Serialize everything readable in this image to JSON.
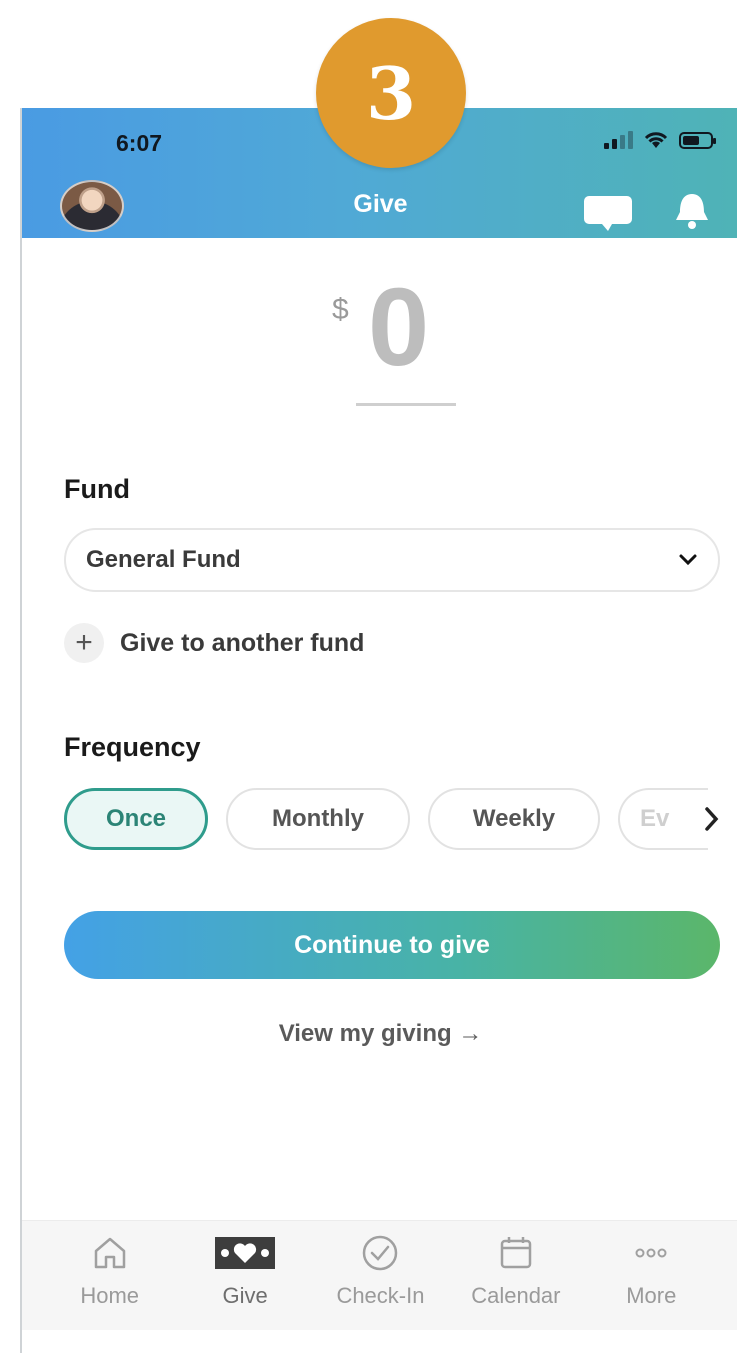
{
  "step": {
    "number": "3"
  },
  "status_bar": {
    "time": "6:07"
  },
  "header": {
    "title": "Give"
  },
  "amount": {
    "currency": "$",
    "value": "0"
  },
  "fund": {
    "label": "Fund",
    "selected": "General Fund",
    "add_another": "Give to another fund"
  },
  "frequency": {
    "label": "Frequency",
    "options": [
      {
        "label": "Once",
        "selected": true
      },
      {
        "label": "Monthly",
        "selected": false
      },
      {
        "label": "Weekly",
        "selected": false
      },
      {
        "label": "Ev",
        "selected": false
      }
    ]
  },
  "actions": {
    "continue": "Continue to give",
    "view_giving": "View my giving →"
  },
  "tabbar": {
    "items": [
      {
        "label": "Home",
        "icon": "home-icon"
      },
      {
        "label": "Give",
        "icon": "give-icon"
      },
      {
        "label": "Check-In",
        "icon": "check-in-icon"
      },
      {
        "label": "Calendar",
        "icon": "calendar-icon"
      },
      {
        "label": "More",
        "icon": "more-icon"
      }
    ]
  },
  "colors": {
    "header_start": "#4a9be3",
    "header_end": "#4fb3b6",
    "step_badge": "#e09a2e",
    "selected_chip": "#2f9c8c",
    "button_start": "#44a1e6",
    "button_end": "#5bb66a"
  }
}
